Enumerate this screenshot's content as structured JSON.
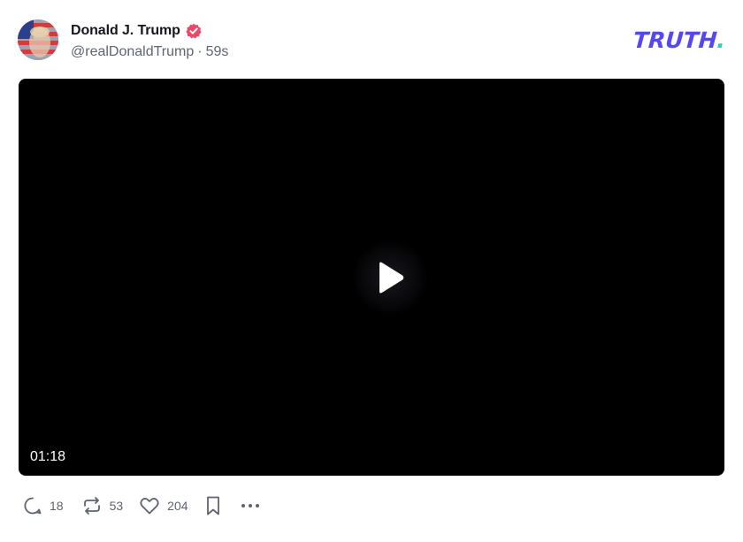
{
  "post": {
    "author": {
      "display_name": "Donald J. Trump",
      "handle": "@realDonaldTrump",
      "separator": "·",
      "timestamp": "59s",
      "verified_icon": "verified-badge-icon",
      "verified_color": "#e64a68"
    },
    "brand": {
      "logo_text": "TRUTH",
      "logo_dot": ".",
      "logo_color": "#5448ee",
      "logo_dot_color": "#21d3b4"
    },
    "media": {
      "type": "video",
      "duration": "01:18",
      "play_icon": "play-icon"
    },
    "actions": {
      "replies": "18",
      "retruths": "53",
      "likes": "204",
      "reply_icon": "reply-icon",
      "retruth_icon": "retruth-icon",
      "like_icon": "heart-icon",
      "bookmark_icon": "bookmark-icon",
      "more_icon": "more-icon"
    }
  }
}
